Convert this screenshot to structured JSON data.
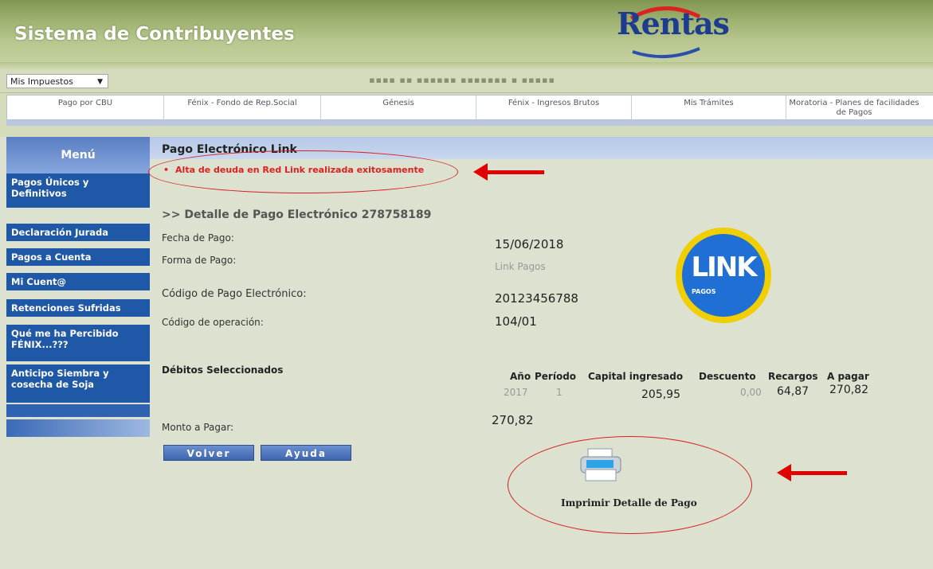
{
  "header": {
    "app_title": "Sistema de Contribuyentes",
    "logo_text": "Rentas"
  },
  "topbar": {
    "impuestos_select": "Mis Impuestos",
    "user_banner": "▪▪▪▪ ▪▪ ▪▪▪▪▪▪ ▪▪▪▪▪▪▪ ▪ ▪▪▪▪▪"
  },
  "nav": [
    {
      "label": "Pago por CBU"
    },
    {
      "label": "Fénix - Fondo de Rep.Social"
    },
    {
      "label": "Génesis"
    },
    {
      "label": "Fénix - Ingresos Brutos"
    },
    {
      "label": "Mis Trámites"
    },
    {
      "label": "Moratoria - Planes de facilidades de Pagos"
    }
  ],
  "sidebar": {
    "title": "Menú",
    "items": [
      {
        "label": "Pagos Únicos y Definitivos"
      },
      {
        "label": "Declaración Jurada"
      },
      {
        "label": "Pagos a Cuenta"
      },
      {
        "label": "Mi Cuent@"
      },
      {
        "label": "Retenciones Sufridas"
      },
      {
        "label": "Qué me ha Percibido FÉNIX...???"
      },
      {
        "label": "Anticipo Siembra y cosecha de Soja"
      }
    ]
  },
  "content": {
    "heading": "Pago Electrónico Link",
    "success_message": "Alta de deuda en Red Link realizada exitosamente",
    "detail_title": ">> Detalle de Pago Electrónico 278758189",
    "fields": {
      "fecha_label": "Fecha de Pago:",
      "fecha_value": "15/06/2018",
      "forma_label": "Forma de Pago:",
      "forma_value": "Link Pagos",
      "codigo_label": "Código de Pago Electrónico:",
      "codigo_value": "20123456788",
      "operacion_label": "Código de operación:",
      "operacion_value": "104/01"
    },
    "debitos_label": "Débitos Seleccionados",
    "table": {
      "headers": [
        "Año",
        "Período",
        "Capital ingresado",
        "Descuento",
        "Recargos",
        "A pagar"
      ],
      "row": [
        "2017",
        "1",
        "205,95",
        "0,00",
        "64,87",
        "270,82"
      ]
    },
    "monto_label": "Monto a Pagar:",
    "monto_value": "270,82",
    "buttons": {
      "volver": "Volver",
      "ayuda": "Ayuda"
    },
    "print_label": "Imprimir Detalle de Pago",
    "link_logo": {
      "big": "LINK",
      "small": "PAGOS"
    }
  },
  "colors": {
    "accent_blue": "#2058a8",
    "error_red": "#e02020",
    "annotation_red": "#e00000"
  }
}
